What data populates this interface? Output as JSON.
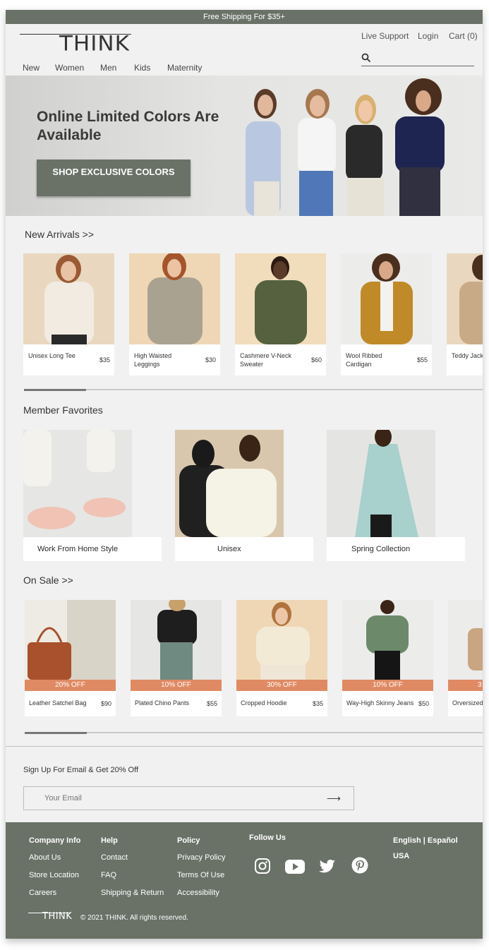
{
  "topbar": {
    "text": "Free Shipping For $35+"
  },
  "header": {
    "logo": "THINK",
    "links": {
      "support": "Live Support",
      "login": "Login",
      "cart": "Cart (0)"
    },
    "nav": [
      "New",
      "Women",
      "Men",
      "Kids",
      "Maternity"
    ]
  },
  "hero": {
    "title": "Online Limited Colors Are Available",
    "button": "SHOP EXCLUSIVE COLORS"
  },
  "new_arrivals": {
    "title": "New Arrivals >>",
    "items": [
      {
        "name": "Unisex Long Tee",
        "price": "$35"
      },
      {
        "name": "High Waisted Leggings",
        "price": "$30"
      },
      {
        "name": "Cashmere V-Neck Sweater",
        "price": "$60"
      },
      {
        "name": "Wool Ribbed Cardigan",
        "price": "$55"
      },
      {
        "name": "Teddy Jack",
        "price": ""
      }
    ]
  },
  "favorites": {
    "title": "Member Favorites",
    "items": [
      {
        "label": "Work From Home Style"
      },
      {
        "label": "Unisex"
      },
      {
        "label": "Spring Collection"
      }
    ]
  },
  "sale": {
    "title": "On Sale >>",
    "items": [
      {
        "badge": "20% OFF",
        "name": "Leather Satchel Bag",
        "price": "$90"
      },
      {
        "badge": "10% OFF",
        "name": "Plated Chino Pants",
        "price": "$55"
      },
      {
        "badge": "30% OFF",
        "name": "Cropped Hoodie",
        "price": "$35"
      },
      {
        "badge": "10% OFF",
        "name": "Way-High Skinny Jeans",
        "price": "$50"
      },
      {
        "badge": "3",
        "name": "Orversized",
        "price": ""
      }
    ]
  },
  "signup": {
    "text": "Sign Up For Email & Get 20% Off",
    "placeholder": "Your Email",
    "arrow": "⟶"
  },
  "footer": {
    "company": {
      "title": "Company Info",
      "links": [
        "About Us",
        "Store Location",
        "Careers"
      ]
    },
    "help": {
      "title": "Help",
      "links": [
        "Contact",
        "FAQ",
        "Shipping & Return"
      ]
    },
    "policy": {
      "title": "Policy",
      "links": [
        "Privacy Policy",
        "Terms Of Use",
        "Accessibility"
      ]
    },
    "follow": {
      "title": "Follow Us",
      "icons": [
        "instagram-icon",
        "youtube-icon",
        "twitter-icon",
        "pinterest-icon"
      ]
    },
    "language": "English | Español",
    "region": "USA",
    "logo": "THINK",
    "copyright": "© 2021 THINK. All rights reserved."
  },
  "colors": {
    "accent": "#6a7268",
    "sale": "#e08a63",
    "background": "#f1f1f1"
  }
}
